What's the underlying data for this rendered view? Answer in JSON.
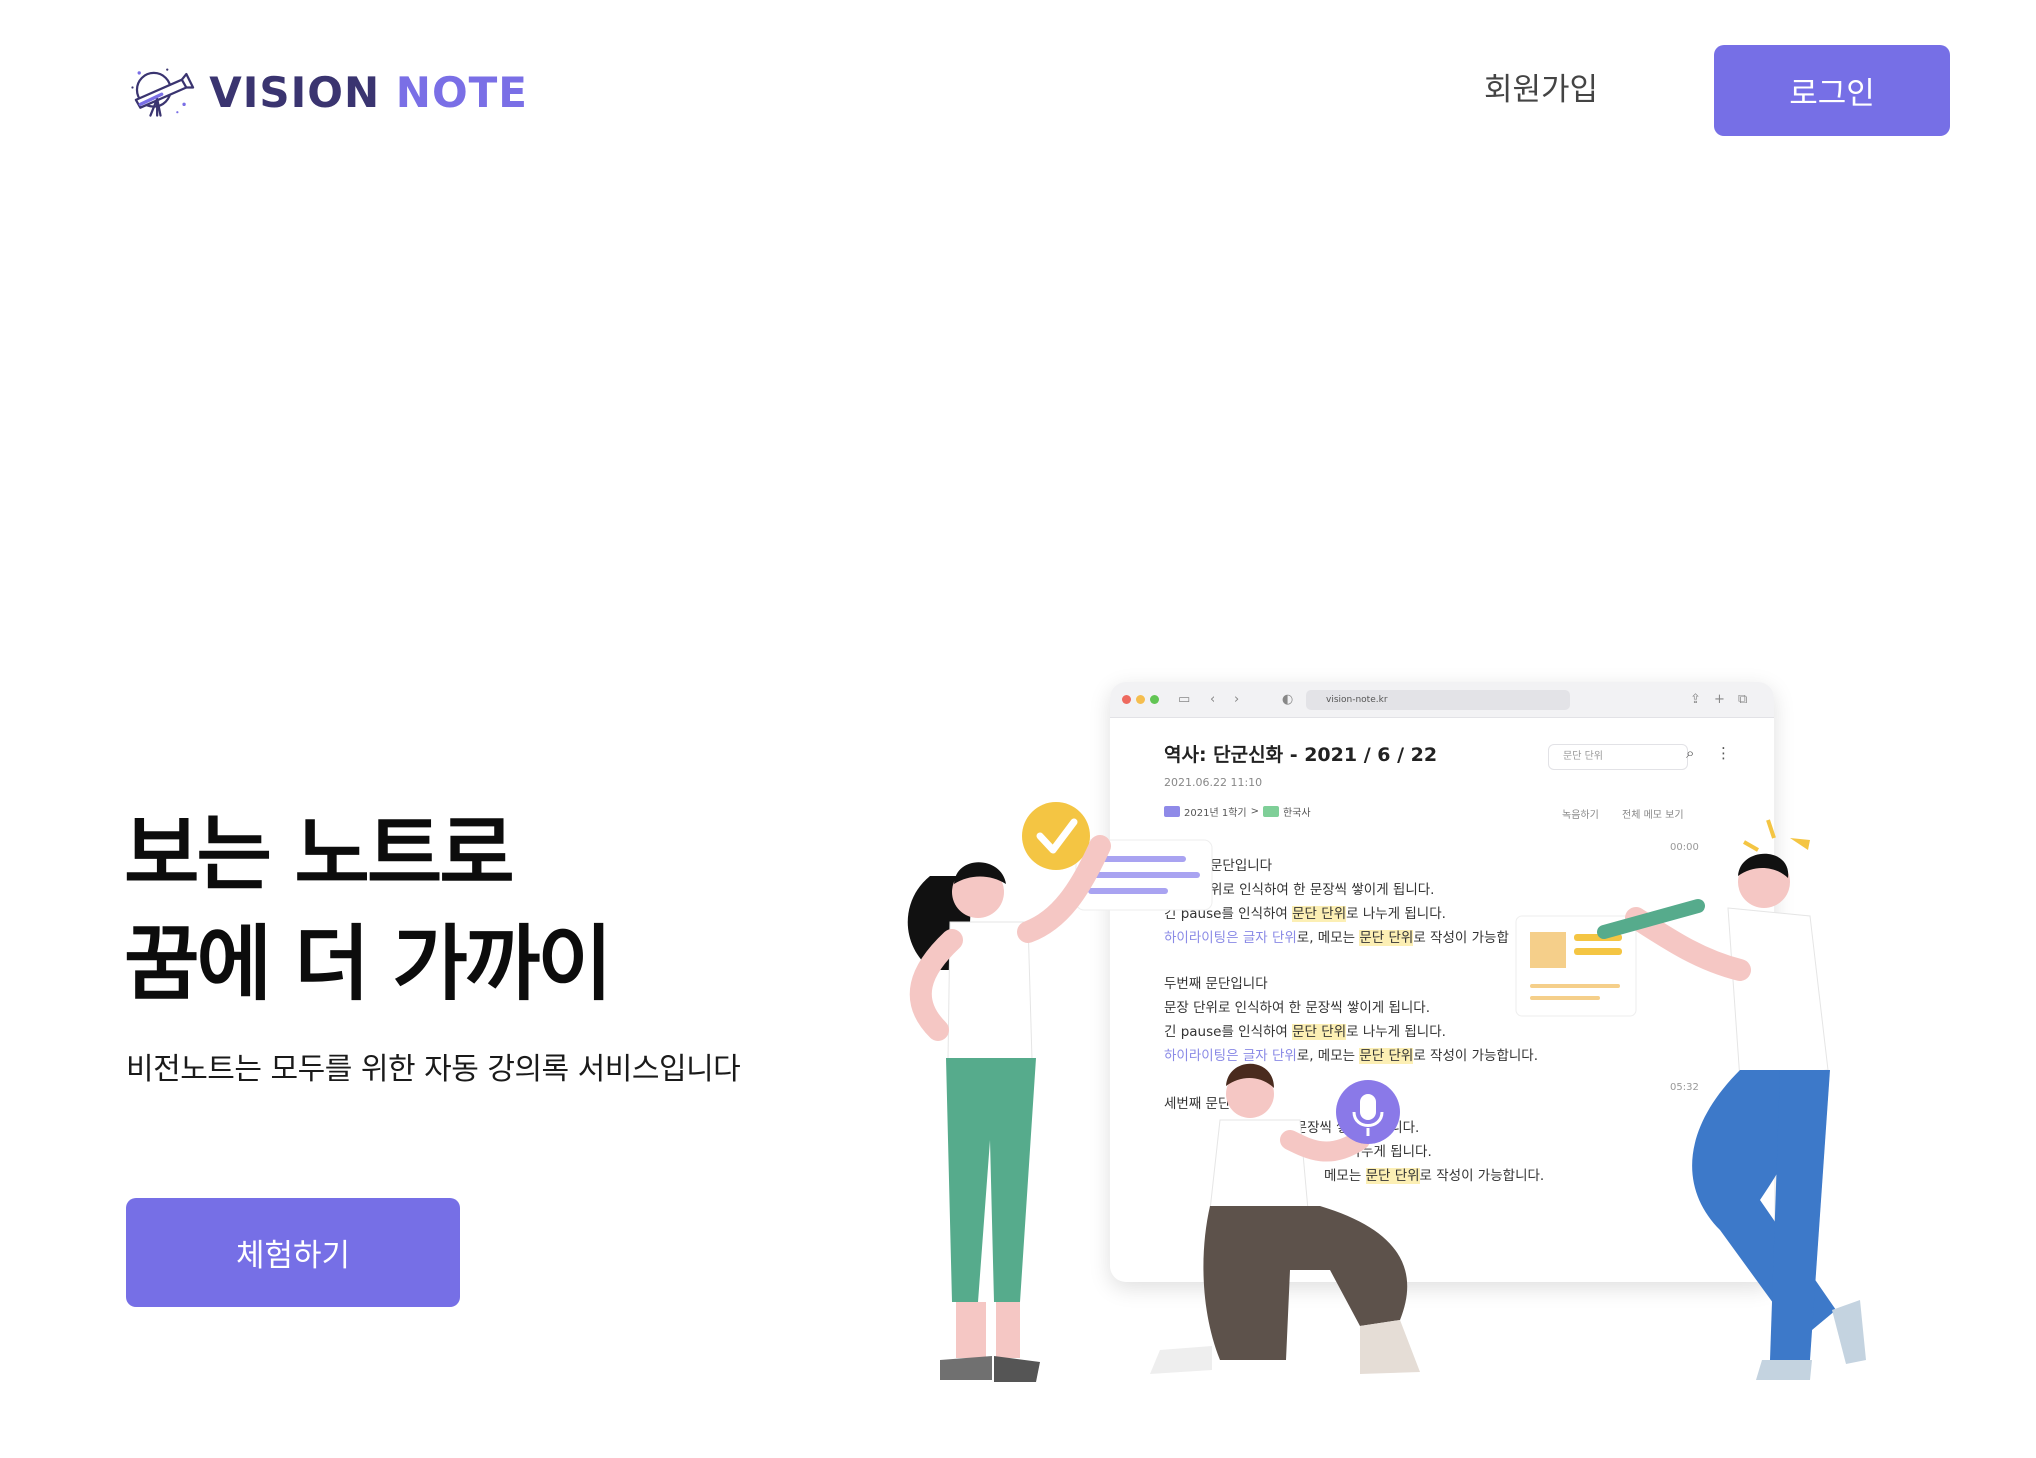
{
  "header": {
    "logo_text_part1": "VISION",
    "logo_text_part2": "NOTE",
    "signup_label": "회원가입",
    "login_label": "로그인"
  },
  "hero": {
    "headline_line1": "보는 노트로",
    "headline_line2": "꿈에 더 가까이",
    "subline": "비전노트는 모두를 위한 자동 강의록 서비스입니다",
    "cta_label": "체험하기"
  },
  "illustration": {
    "browser": {
      "url": "vision-note.kr",
      "note_title": "역사: 단군신화 - 2021 / 6 / 22",
      "note_date": "2021.06.22 11:10",
      "crumb_1": "2021년 1학기",
      "crumb_separator": ">",
      "crumb_2": "한국사",
      "search_placeholder": "문단 단위",
      "tool_record": "녹음하기",
      "tool_memo": "전체 메모 보기",
      "timestamp_1": "00:00",
      "timestamp_2": "05:32",
      "para1": {
        "l1": "문단입니다",
        "l2": "위로 인식하여 한 문장씩 쌓이게 됩니다.",
        "l3a": "긴 pause를 인식하여 ",
        "l3b": "문단 단위",
        "l3c": "로 나누게 됩니다.",
        "l4a": "하이라이팅은 ",
        "l4b": "글자 단위",
        "l4c": "로, 메모는 ",
        "l4d": "문단 단위",
        "l4e": "로 작성이 가능합"
      },
      "para2": {
        "l1": "두번째 문단입니다",
        "l2": "문장 단위로 인식하여 한 문장씩 쌓이게 됩니다.",
        "l3a": "긴 pause를 인식하여 ",
        "l3b": "문단 단위",
        "l3c": "로 나누게 됩니다.",
        "l4a": "하이라이팅은 ",
        "l4b": "글자 단위",
        "l4c": "로, 메모는 ",
        "l4d": "문단 단위",
        "l4e": "로 작성이 가능합니다."
      },
      "para3": {
        "l1": "세번째 문단입니다",
        "l2": "인식하여 한 문장씩 쌓이게 됩니다.",
        "l3": "인식하여 문단 단위로 나누게 됩니다.",
        "l4a": "메모는 ",
        "l4b": "문단 단위",
        "l4c": "로 작성이 가능합니다."
      }
    }
  },
  "colors": {
    "accent": "#766fe6",
    "logo_dark": "#3a3470",
    "logo_light": "#7a6fe6",
    "highlight": "#fcefb4"
  }
}
